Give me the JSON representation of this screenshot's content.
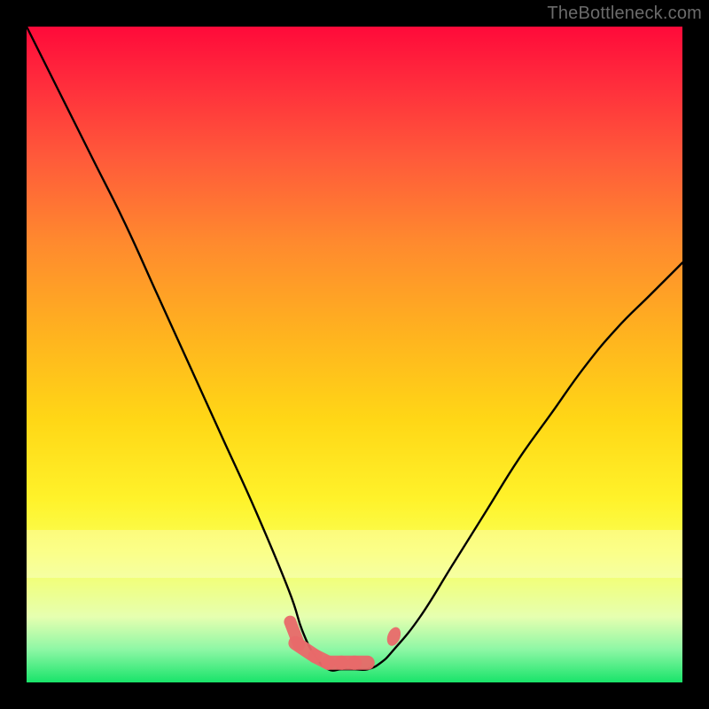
{
  "watermark": "TheBottleneck.com",
  "chart_data": {
    "type": "line",
    "title": "",
    "xlabel": "",
    "ylabel": "",
    "xlim": [
      0,
      100
    ],
    "ylim": [
      0,
      100
    ],
    "grid": false,
    "legend": false,
    "series": [
      {
        "name": "bottleneck-curve",
        "x": [
          0,
          5,
          10,
          15,
          20,
          25,
          30,
          35,
          40,
          42,
          44,
          46,
          48,
          50,
          52,
          54,
          56,
          60,
          65,
          70,
          75,
          80,
          85,
          90,
          95,
          100
        ],
        "y": [
          100,
          90,
          80,
          70,
          59,
          48,
          37,
          26,
          14,
          8,
          4,
          2,
          2,
          2,
          2,
          3,
          5,
          10,
          18,
          26,
          34,
          41,
          48,
          54,
          59,
          64
        ]
      }
    ],
    "markers": [
      {
        "name": "flat-bottom-squiggle",
        "shape": "segmented-blob",
        "color": "#e96a6a",
        "x": [
          41,
          44,
          46,
          48,
          50,
          52
        ],
        "y": [
          6,
          4,
          3,
          3,
          3,
          3
        ]
      },
      {
        "name": "right-dot",
        "shape": "dot",
        "color": "#e96a6a",
        "x": [
          56
        ],
        "y": [
          7
        ]
      }
    ],
    "background_gradient": {
      "top": "#ff0a3a",
      "upper_mid": "#ffb31f",
      "lower_mid": "#fff22a",
      "bottom": "#19e46a"
    },
    "pale_band_y": [
      19,
      26
    ]
  }
}
